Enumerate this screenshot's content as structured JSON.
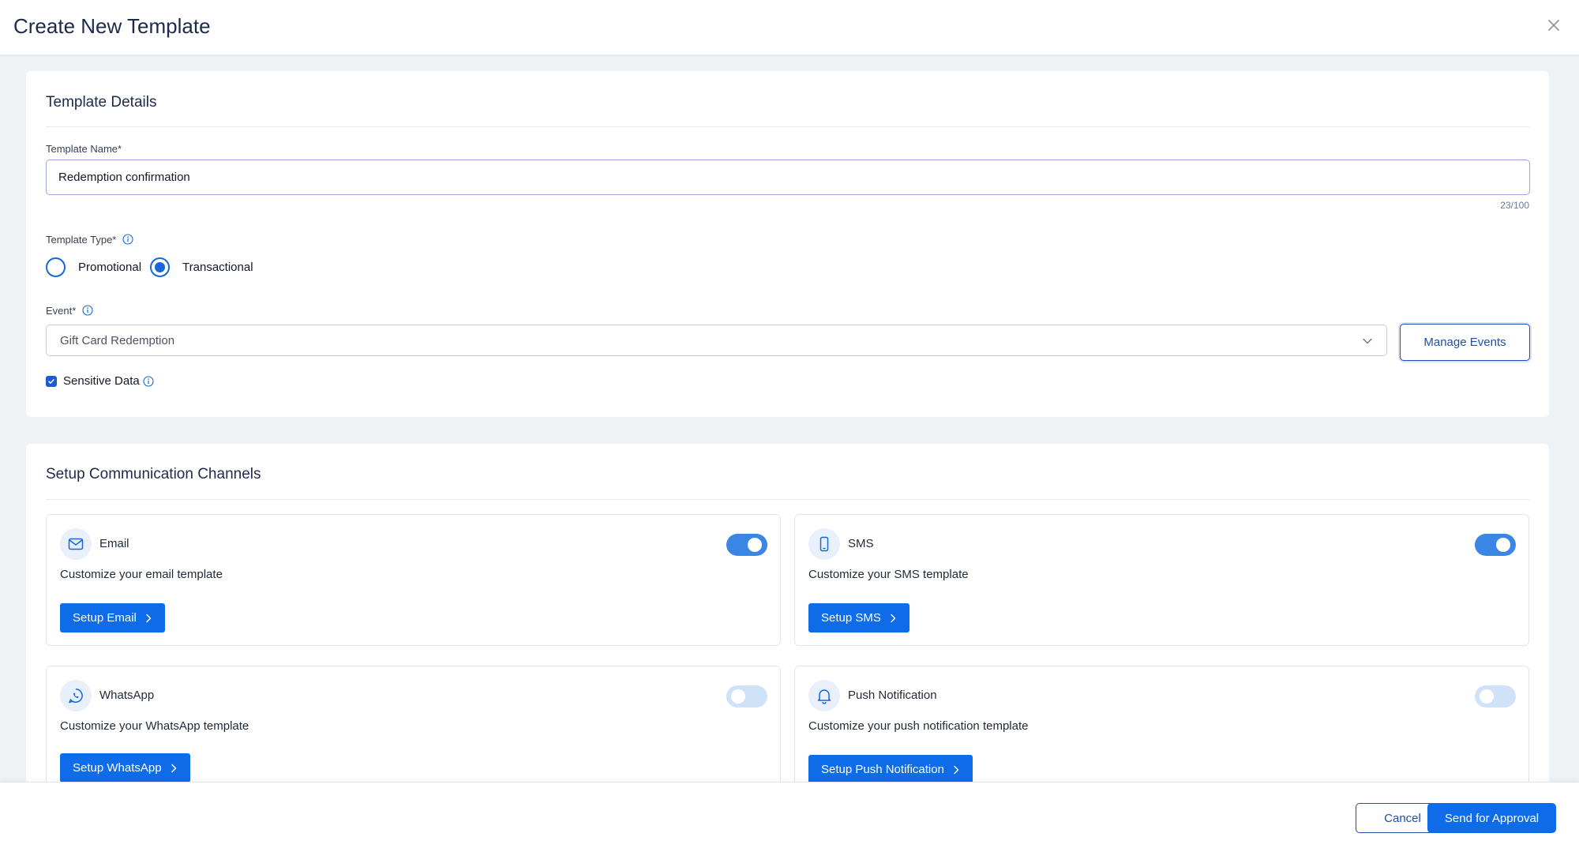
{
  "header": {
    "title": "Create New Template"
  },
  "details": {
    "section_title": "Template Details",
    "name_label": "Template Name*",
    "name_value": "Redemption confirmation",
    "name_counter": "23/100",
    "type_label": "Template Type*",
    "type_options": [
      {
        "label": "Promotional",
        "checked": false
      },
      {
        "label": "Transactional",
        "checked": true
      }
    ],
    "event_label": "Event*",
    "event_value": "Gift Card Redemption",
    "manage_events_label": "Manage Events",
    "sensitive_label": "Sensitive Data",
    "sensitive_checked": true
  },
  "channels": {
    "section_title": "Setup Communication Channels",
    "items": [
      {
        "name": "Email",
        "icon": "mail-icon",
        "description": "Customize your email template",
        "button": "Setup Email",
        "enabled": true
      },
      {
        "name": "SMS",
        "icon": "mobile-icon",
        "description": "Customize your SMS template",
        "button": "Setup SMS",
        "enabled": true
      },
      {
        "name": "WhatsApp",
        "icon": "whatsapp-icon",
        "description": "Customize your WhatsApp template",
        "button": "Setup WhatsApp",
        "enabled": false
      },
      {
        "name": "Push Notification",
        "icon": "bell-icon",
        "description": "Customize your push notification template",
        "button": "Setup Push Notification",
        "enabled": false
      }
    ]
  },
  "footer": {
    "cancel_label": "Cancel",
    "submit_label": "Send for Approval"
  },
  "colors": {
    "primary": "#0f6ce8",
    "toggle_on": "#3b86e5",
    "toggle_off": "#cfe2f7",
    "accent_outline": "#1f4fa8"
  }
}
